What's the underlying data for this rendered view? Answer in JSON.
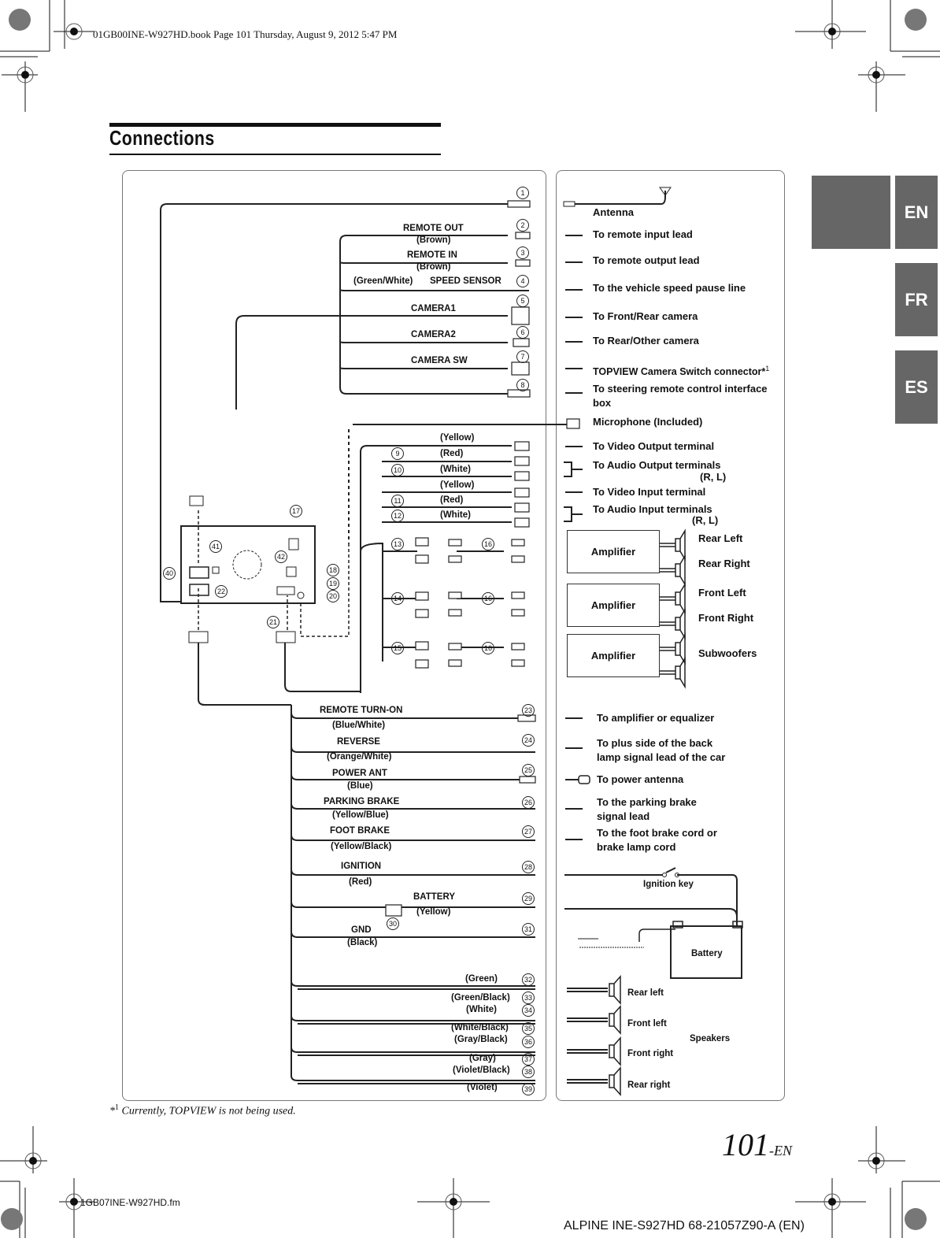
{
  "header": {
    "book_info": "01GB00INE-W927HD.book  Page 101  Thursday, August 9, 2012  5:47 PM"
  },
  "page_title": "Connections",
  "language_tabs": [
    {
      "label": "EN",
      "active": true
    },
    {
      "label": "FR",
      "active": false
    },
    {
      "label": "ES",
      "active": false
    }
  ],
  "left_wires_top": [
    {
      "num": "1",
      "name": "",
      "color": ""
    },
    {
      "num": "2",
      "name": "REMOTE OUT",
      "color": "(Brown)"
    },
    {
      "num": "3",
      "name": "REMOTE IN",
      "color": "(Brown)"
    },
    {
      "num": "4",
      "name": "SPEED SENSOR",
      "color": "(Green/White)"
    },
    {
      "num": "5",
      "name": "CAMERA1",
      "color": ""
    },
    {
      "num": "6",
      "name": "CAMERA2",
      "color": ""
    },
    {
      "num": "7",
      "name": "CAMERA SW",
      "color": ""
    },
    {
      "num": "8",
      "name": "",
      "color": ""
    }
  ],
  "right_destinations_top": [
    {
      "text": "Antenna"
    },
    {
      "text": "To remote input lead"
    },
    {
      "text": "To remote output lead"
    },
    {
      "text": "To the vehicle speed pause line"
    },
    {
      "text": "To Front/Rear camera"
    },
    {
      "text": "To Rear/Other camera"
    },
    {
      "text": "TOPVIEW Camera Switch connector*",
      "sup": "1"
    },
    {
      "text": "To steering remote control interface",
      "text2": "box"
    },
    {
      "text": "Microphone (Included)"
    }
  ],
  "av_cables": [
    {
      "color": "(Yellow)"
    },
    {
      "color": "(Red)"
    },
    {
      "color": "(White)"
    },
    {
      "color": "(Yellow)"
    },
    {
      "color": "(Red)"
    },
    {
      "color": "(White)"
    }
  ],
  "av_nums": [
    "9",
    "10",
    "11",
    "12",
    "13",
    "14",
    "15",
    "16",
    "16",
    "16"
  ],
  "av_destinations": [
    {
      "text": "To Video Output terminal"
    },
    {
      "text": "To Audio Output terminals",
      "sub": "(R, L)"
    },
    {
      "text": "To Video Input terminal"
    },
    {
      "text": "To Audio Input terminals",
      "sub": "(R, L)"
    }
  ],
  "amplifiers": [
    {
      "label": "Amplifier",
      "outputs": [
        "Rear Left",
        "Rear Right"
      ]
    },
    {
      "label": "Amplifier",
      "outputs": [
        "Front Left",
        "Front Right"
      ]
    },
    {
      "label": "Amplifier",
      "outputs": [
        "Subwoofers"
      ]
    }
  ],
  "unit_nums": [
    "17",
    "18",
    "19",
    "20",
    "21",
    "22",
    "40",
    "41",
    "42"
  ],
  "power_wires": [
    {
      "num": "23",
      "name": "REMOTE TURN-ON",
      "color": "(Blue/White)",
      "dest": "To amplifier or equalizer"
    },
    {
      "num": "24",
      "name": "REVERSE",
      "color": "(Orange/White)",
      "dest": "To plus side of the back",
      "dest2": "lamp signal lead of the car"
    },
    {
      "num": "25",
      "name": "POWER ANT",
      "color": "(Blue)",
      "dest": "To power antenna"
    },
    {
      "num": "26",
      "name": "PARKING BRAKE",
      "color": "(Yellow/Blue)",
      "dest": "To the parking brake",
      "dest2": "signal lead"
    },
    {
      "num": "27",
      "name": "FOOT BRAKE",
      "color": "(Yellow/Black)",
      "dest": "To the foot brake cord or",
      "dest2": "brake lamp cord"
    },
    {
      "num": "28",
      "name": "IGNITION",
      "color": "(Red)"
    },
    {
      "num": "29",
      "name": "BATTERY",
      "color": "(Yellow)"
    },
    {
      "num": "30",
      "name": "",
      "color": ""
    },
    {
      "num": "31",
      "name": "GND",
      "color": "(Black)"
    }
  ],
  "battery_area": {
    "ignition_key": "Ignition key",
    "battery": "Battery"
  },
  "speaker_wires": [
    {
      "num": "32",
      "color": "(Green)"
    },
    {
      "num": "33",
      "color": "(Green/Black)"
    },
    {
      "num": "34",
      "color": "(White)"
    },
    {
      "num": "35",
      "color": "(White/Black)"
    },
    {
      "num": "36",
      "color": "(Gray/Black)"
    },
    {
      "num": "37",
      "color": "(Gray)"
    },
    {
      "num": "38",
      "color": "(Violet/Black)"
    },
    {
      "num": "39",
      "color": "(Violet)"
    }
  ],
  "speakers": {
    "group_label": "Speakers",
    "items": [
      "Rear left",
      "Front left",
      "Front right",
      "Rear right"
    ]
  },
  "footnote": {
    "marker": "*",
    "sup": "1",
    "text": "Currently, TOPVIEW is not being used."
  },
  "page_number": {
    "num": "101",
    "suffix": "-EN"
  },
  "footer": {
    "file": "1GB07INE-W927HD.fm",
    "model": "ALPINE INE-S927HD 68-21057Z90-A (EN)"
  }
}
